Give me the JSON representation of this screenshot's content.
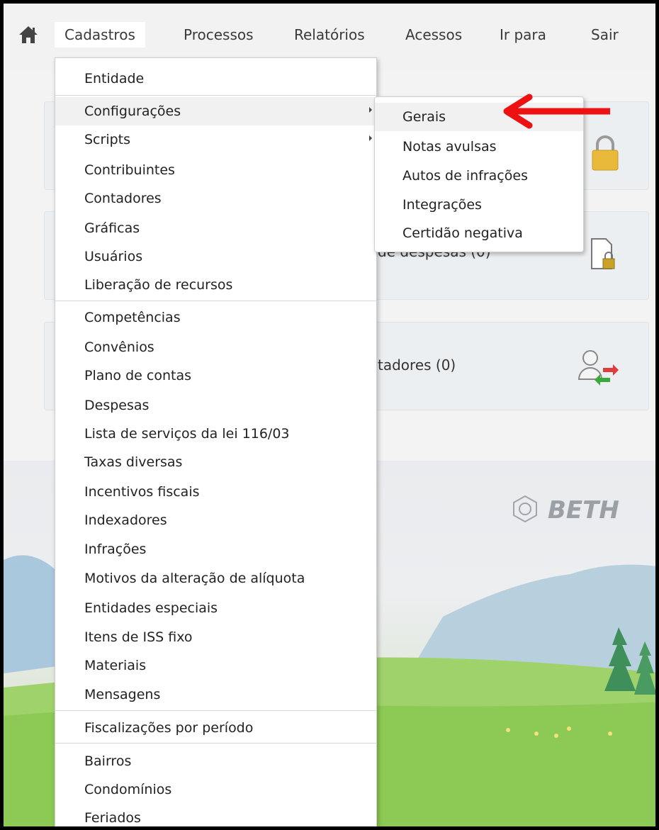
{
  "nav": {
    "items": [
      "Cadastros",
      "Processos",
      "Relatórios",
      "Acessos",
      "Ir para",
      "Sair"
    ]
  },
  "cards": [
    {
      "text": "",
      "icon": "lock-icon"
    },
    {
      "text": "de despesas (0)",
      "icon": "document-lock-icon"
    },
    {
      "text": "tadores (0)",
      "icon": "users-transfer-icon"
    }
  ],
  "brand": "BETH",
  "menu": {
    "items": [
      "Entidade",
      "Configurações",
      "Scripts",
      "Contribuintes",
      "Contadores",
      "Gráficas",
      "Usuários",
      "Liberação de recursos",
      "Competências",
      "Convênios",
      "Plano de contas",
      "Despesas",
      "Lista de serviços da lei 116/03",
      "Taxas diversas",
      "Incentivos fiscais",
      "Indexadores",
      "Infrações",
      "Motivos da alteração de alíquota",
      "Entidades especiais",
      "Itens de ISS fixo",
      "Materiais",
      "Mensagens",
      "Fiscalizações por período",
      "Bairros",
      "Condomínios",
      "Feriados"
    ]
  },
  "submenu": {
    "items": [
      "Gerais",
      "Notas avulsas",
      "Autos de infrações",
      "Integrações",
      "Certidão negativa"
    ]
  },
  "colors": {
    "arrow": "#ee1111",
    "menu_hover": "#f1f1f1"
  }
}
